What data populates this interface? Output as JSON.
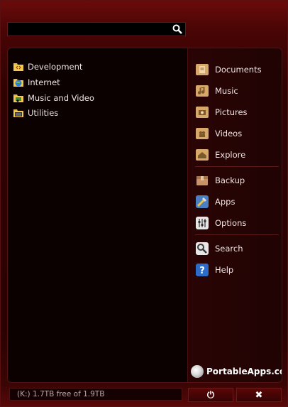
{
  "search": {
    "value": "",
    "placeholder": ""
  },
  "categories": [
    {
      "label": "Development",
      "icon": "development-folder-icon"
    },
    {
      "label": "Internet",
      "icon": "internet-folder-icon"
    },
    {
      "label": "Music and Video",
      "icon": "music-video-folder-icon"
    },
    {
      "label": "Utilities",
      "icon": "utilities-folder-icon"
    }
  ],
  "shortcuts": [
    {
      "label": "Documents",
      "icon": "documents-icon"
    },
    {
      "label": "Music",
      "icon": "music-icon"
    },
    {
      "label": "Pictures",
      "icon": "pictures-icon"
    },
    {
      "label": "Videos",
      "icon": "videos-icon"
    },
    {
      "label": "Explore",
      "icon": "explore-icon"
    }
  ],
  "tools": [
    {
      "label": "Backup",
      "icon": "backup-icon"
    },
    {
      "label": "Apps",
      "icon": "apps-icon"
    },
    {
      "label": "Options",
      "icon": "options-icon"
    }
  ],
  "help": [
    {
      "label": "Search",
      "icon": "search-help-icon"
    },
    {
      "label": "Help",
      "icon": "help-icon"
    }
  ],
  "brand": {
    "name": "PortableApps.com"
  },
  "status": {
    "drive_text": "(K:) 1.7TB free of 1.9TB"
  },
  "buttons": {
    "power_glyph": "⏻",
    "close_glyph": "✖"
  },
  "colors": {
    "accent": "#4a0505",
    "panel": "#0b0101",
    "border": "#531212"
  }
}
